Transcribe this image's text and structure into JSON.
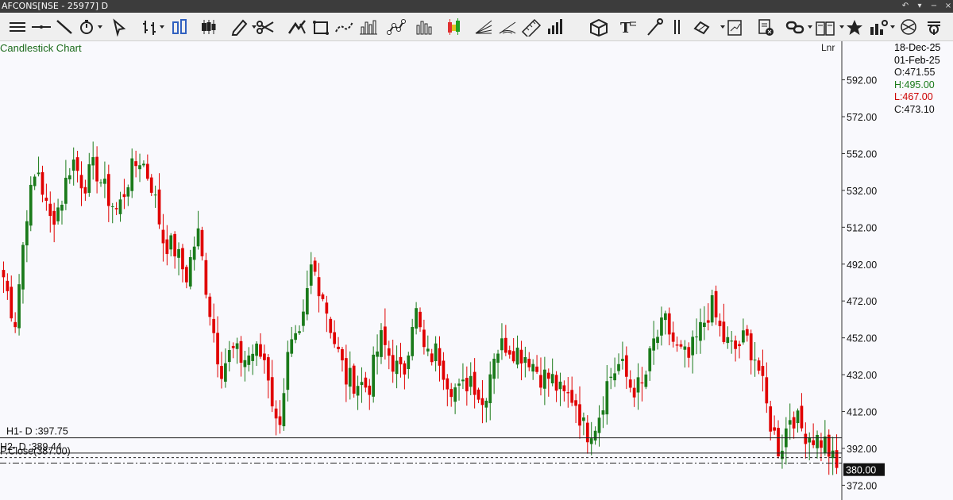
{
  "titlebar": {
    "title": "AFCONS[NSE - 25977] D",
    "controls": [
      "undo-icon",
      "dropdown-icon",
      "restore-icon",
      "close-icon"
    ]
  },
  "toolbar": {
    "tools": [
      "menu-lines-icon",
      "horizontal-line-icon",
      "trend-line-icon",
      "stopwatch-icon",
      "cursor-icon",
      "bar-chart-icon",
      "hollow-candle-icon",
      "candle-icon",
      "pencil-icon",
      "scissors-icon",
      "pitchfork-icon",
      "rectangle-icon",
      "wave-icon",
      "histogram-icon",
      "linked-points-icon",
      "volume-bars-icon",
      "color-candles-icon",
      "fan-icon",
      "arc-icon",
      "ruler-icon",
      "rising-bars-icon",
      "cube-icon",
      "text-tool-icon",
      "tools-icon",
      "columns-icon",
      "hand-icon",
      "drawing-pad-icon",
      "delete-doc-icon",
      "link-icon",
      "book-icon",
      "star-icon",
      "indicator-icon",
      "compare-icon",
      "magnet-icon"
    ]
  },
  "chart": {
    "title": "Candlestick Chart",
    "scale_mode": "Lnr",
    "info": {
      "date": "18-Dec-25",
      "date2": "01-Feb-25",
      "open": "O:471.55",
      "high": "H:495.00",
      "low": "L:467.00",
      "close": "C:473.10",
      "open_color": "#111111",
      "high_color": "#1a7a1a",
      "low_color": "#cc0000",
      "close_color": "#111111"
    },
    "levels": [
      {
        "label": "H1- D :397.75",
        "value": 397.75,
        "style": "solid"
      },
      {
        "label": "H2- D :389.44",
        "value": 389.44,
        "style": "solid"
      },
      {
        "label": "P.Close(387.00)",
        "value": 387.0,
        "style": "dashed"
      },
      {
        "label": "",
        "value": 384.0,
        "style": "dashdot"
      }
    ],
    "last_price_label": "380.00"
  },
  "chart_data": {
    "type": "candlestick",
    "title": "Candlestick Chart",
    "ylim": [
      364,
      600
    ],
    "y_ticks": [
      "592.00",
      "572.00",
      "552.00",
      "532.00",
      "512.00",
      "492.00",
      "472.00",
      "452.00",
      "432.00",
      "412.00",
      "392.00",
      "372.00"
    ],
    "y_tick_values": [
      592,
      572,
      552,
      532,
      512,
      492,
      472,
      452,
      432,
      412,
      392,
      372
    ],
    "bull_color": "#1a7a1a",
    "bear_color": "#e00000",
    "series": [
      {
        "name": "AFCONS",
        "path": [
          [
            500,
            485
          ],
          [
            495,
            460
          ],
          [
            480,
            520
          ],
          [
            535,
            545
          ],
          [
            540,
            515
          ],
          [
            490,
            525
          ],
          [
            530,
            550
          ],
          [
            545,
            535
          ],
          [
            525,
            545
          ],
          [
            560,
            530
          ],
          [
            505,
            520
          ],
          [
            545,
            540
          ],
          [
            525,
            550
          ],
          [
            540,
            535
          ],
          [
            525,
            505
          ],
          [
            490,
            500
          ],
          [
            510,
            485
          ],
          [
            525,
            510
          ],
          [
            470,
            470
          ],
          [
            450,
            435
          ],
          [
            460,
            445
          ],
          [
            420,
            440
          ],
          [
            455,
            445
          ],
          [
            420,
            440
          ],
          [
            405,
            400
          ],
          [
            425,
            445
          ],
          [
            455,
            450
          ],
          [
            470,
            492
          ],
          [
            480,
            475
          ],
          [
            480,
            450
          ],
          [
            455,
            430
          ],
          [
            440,
            428
          ],
          [
            410,
            425
          ],
          [
            440,
            452
          ],
          [
            450,
            440
          ],
          [
            420,
            430
          ],
          [
            462,
            470
          ],
          [
            455,
            440
          ],
          [
            452,
            445
          ],
          [
            430,
            428
          ],
          [
            427,
            422
          ],
          [
            420,
            432
          ],
          [
            432,
            415
          ],
          [
            428,
            445
          ],
          [
            455,
            449
          ],
          [
            448,
            445
          ],
          [
            440,
            442
          ],
          [
            438,
            432
          ],
          [
            428,
            430
          ],
          [
            425,
            420
          ],
          [
            418,
            420
          ],
          [
            395,
            400
          ],
          [
            402,
            407
          ],
          [
            420,
            430
          ],
          [
            432,
            438
          ],
          [
            435,
            425
          ],
          [
            418,
            425
          ],
          [
            442,
            450
          ],
          [
            455,
            460
          ],
          [
            452,
            445
          ],
          [
            450,
            440
          ],
          [
            460,
            455
          ],
          [
            448,
            470
          ],
          [
            465,
            452
          ],
          [
            450,
            445
          ],
          [
            440,
            452
          ],
          [
            450,
            440
          ],
          [
            400,
            410
          ],
          [
            396,
            390
          ],
          [
            402,
            412
          ],
          [
            405,
            402
          ],
          [
            400,
            398
          ],
          [
            396,
            395
          ],
          [
            392,
            380
          ]
        ]
      }
    ]
  }
}
